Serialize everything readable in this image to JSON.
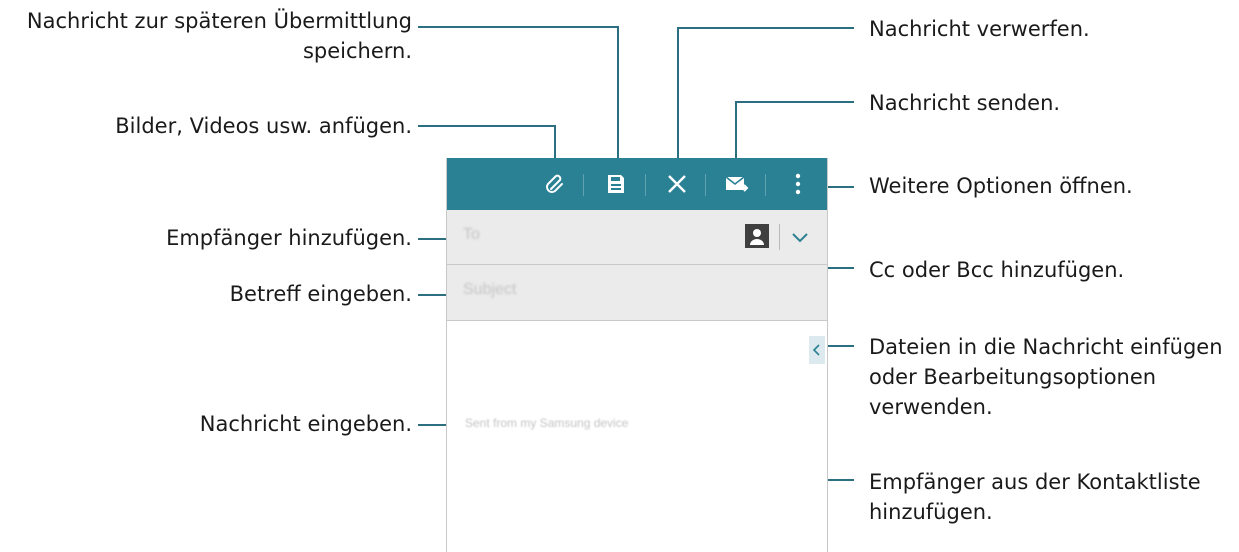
{
  "annotations": {
    "save_later_line1": "Nachricht zur späteren Übermittlung",
    "save_later_line2": "speichern.",
    "attach": "Bilder, Videos usw. anfügen.",
    "add_recipients": "Empfänger hinzufügen.",
    "enter_subject": "Betreff eingeben.",
    "enter_message": "Nachricht eingeben.",
    "discard": "Nachricht verwerfen.",
    "send": "Nachricht senden.",
    "more_options": "Weitere Optionen öffnen.",
    "cc_bcc": "Cc oder Bcc hinzufügen.",
    "insert_files_line1": "Dateien in die Nachricht einfügen",
    "insert_files_line2": "oder Bearbeitungsoptionen",
    "insert_files_line3": "verwenden.",
    "contacts_line1": "Empfänger aus der Kontaktliste",
    "contacts_line2": "hinzufügen."
  },
  "compose": {
    "to_placeholder": "To",
    "subject_placeholder": "Subject",
    "signature": "Sent from my Samsung device"
  },
  "actionbar_icons": [
    "paperclip-icon",
    "save-icon",
    "close-icon",
    "send-mail-icon",
    "more-vert-icon"
  ],
  "colors": {
    "actionbar": "#2a8193",
    "callout_line": "#2b6f80"
  }
}
